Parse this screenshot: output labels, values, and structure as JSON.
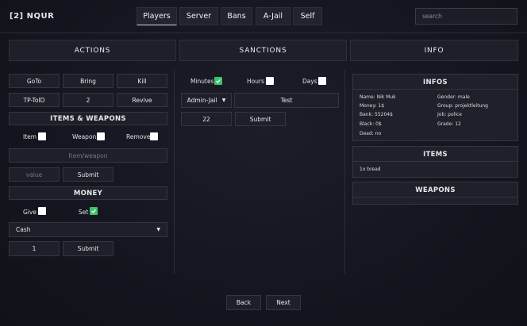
{
  "header": {
    "title": "[2] NQUR",
    "tabs": [
      {
        "label": "Players",
        "active": true
      },
      {
        "label": "Server"
      },
      {
        "label": "Bans"
      },
      {
        "label": "A-Jail"
      },
      {
        "label": "Self"
      }
    ],
    "search_placeholder": "search"
  },
  "sections": {
    "actions": "ACTIONS",
    "sanctions": "SANCTIONS",
    "info": "INFO"
  },
  "actions": {
    "buttons": [
      "GoTo",
      "Bring",
      "Kill",
      "TP-ToID",
      "2",
      "Revive"
    ],
    "items_weapons": {
      "header": "ITEMS & WEAPONS",
      "item_label": "Item",
      "weapon_label": "Weapon",
      "remove_label": "Remove",
      "item_weapon_placeholder": "Item/weapon",
      "value_placeholder": "value",
      "submit": "Submit"
    },
    "money": {
      "header": "MONEY",
      "give_label": "Give",
      "set_label": "Set",
      "give_checked": false,
      "set_checked": true,
      "account_selected": "Cash",
      "amount_value": "1",
      "submit": "Submit"
    }
  },
  "sanctions": {
    "minutes_label": "Minutes",
    "hours_label": "Hours",
    "days_label": "Days",
    "minutes_checked": true,
    "type_selected": "Admin-Jail",
    "reason_value": "Test",
    "duration_value": "22",
    "submit": "Submit"
  },
  "info": {
    "infos_header": "INFOS",
    "name": "Name: Nik Muk",
    "gender": "Gender: male",
    "money": "Money: 1$",
    "group": "Group: projektleitung",
    "bank": "Bank: 55204$",
    "job": "Job: police",
    "black": "Black: 0$",
    "grade": "Grade: 12",
    "dead": "Dead: no",
    "items_header": "ITEMS",
    "items": [
      "1x bread"
    ],
    "weapons_header": "WEAPONS"
  },
  "footer": {
    "back": "Back",
    "next": "Next"
  },
  "colors": {
    "check_green": "#3cc469",
    "background": "#15151f",
    "panel": "#1e1f28"
  }
}
